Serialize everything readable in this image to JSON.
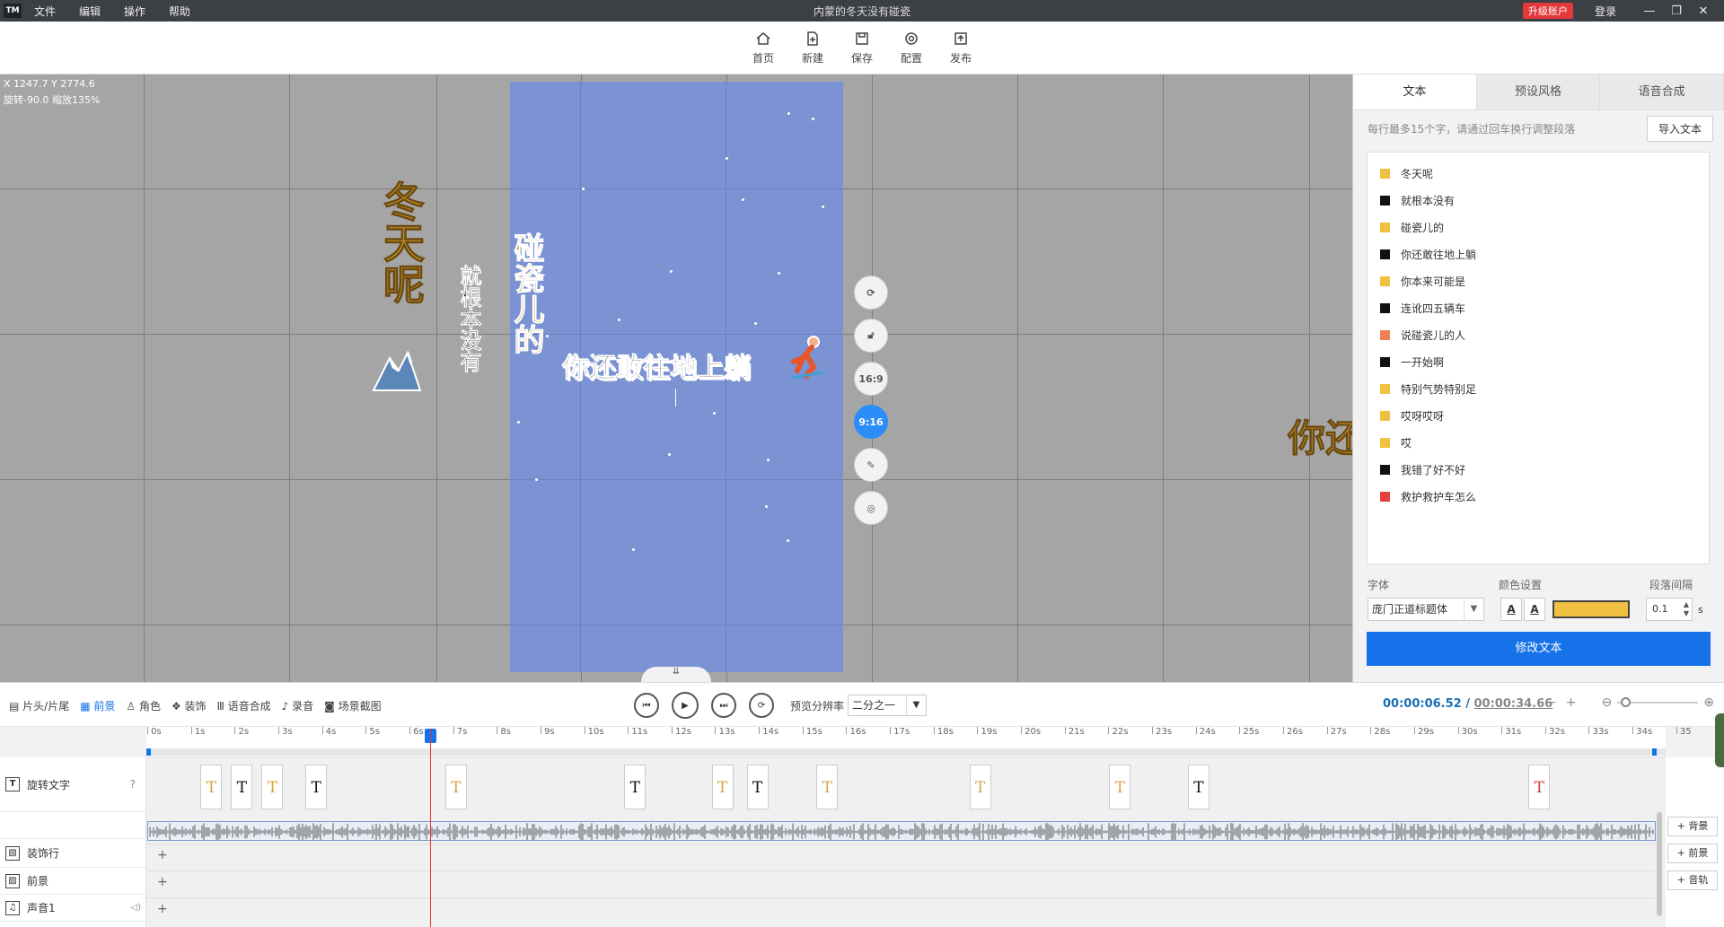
{
  "app": {
    "logo": "TM",
    "title": "内蒙的冬天没有碰瓷",
    "menu": [
      "文件",
      "编辑",
      "操作",
      "帮助"
    ],
    "upgrade_label": "升级账户",
    "login_label": "登录",
    "window_controls": [
      "minimize-icon",
      "restore-icon",
      "close-icon"
    ]
  },
  "toolbar": {
    "items": [
      {
        "label": "首页",
        "icon": "home-icon"
      },
      {
        "label": "新建",
        "icon": "new-icon"
      },
      {
        "label": "保存",
        "icon": "save-icon"
      },
      {
        "label": "配置",
        "icon": "settings-icon"
      },
      {
        "label": "发布",
        "icon": "publish-icon"
      }
    ]
  },
  "stage": {
    "coords_line1": "X 1247.7 Y 2774.6",
    "coords_line2": "旋转-90.0 缩放135%",
    "captions": {
      "c1": "冬天呢",
      "c2": "就根本没有",
      "c3": "碰瓷儿的",
      "main": "你还敢往地上躺",
      "right": "你还"
    },
    "side_buttons": [
      {
        "icon": "rotate-icon",
        "label": ""
      },
      {
        "icon": "unlock-icon",
        "label": ""
      },
      {
        "icon": "",
        "label": "16:9"
      },
      {
        "icon": "",
        "label": "9:16",
        "active": true
      },
      {
        "icon": "edit-icon",
        "label": ""
      },
      {
        "icon": "target-icon",
        "label": ""
      }
    ],
    "collapse_icon": "⇊"
  },
  "right_panel": {
    "tabs": [
      "文本",
      "预设风格",
      "语音合成"
    ],
    "hint": "每行最多15个字，请通过回车换行调整段落",
    "import_label": "导入文本",
    "lines": [
      {
        "text": "冬天呢",
        "color": "#f0c040"
      },
      {
        "text": "就根本没有",
        "color": "#111111"
      },
      {
        "text": "碰瓷儿的",
        "color": "#f0c040"
      },
      {
        "text": "你还敢往地上躺",
        "color": "#111111"
      },
      {
        "text": "你本来可能是",
        "color": "#f0c040"
      },
      {
        "text": "连讹四五辆车",
        "color": "#111111"
      },
      {
        "text": "说碰瓷儿的人",
        "color": "#f08050"
      },
      {
        "text": "一开始啊",
        "color": "#111111"
      },
      {
        "text": "特别气势特别足",
        "color": "#f0c040"
      },
      {
        "text": "哎呀哎呀",
        "color": "#f0c040"
      },
      {
        "text": "哎",
        "color": "#f0c040"
      },
      {
        "text": "我错了好不好",
        "color": "#111111"
      },
      {
        "text": "救护救护车怎么",
        "color": "#e84040"
      }
    ],
    "font_label": "字体",
    "color_label": "颜色设置",
    "spacing_label": "段落间隔",
    "font_value": "庞门正道标题体",
    "fill_color": "#f0c040",
    "spacing_value": "0.1",
    "spacing_unit": "s",
    "modify_label": "修改文本"
  },
  "timeline": {
    "toolbar": [
      {
        "label": "片头/片尾",
        "icon": "film-icon"
      },
      {
        "label": "前景",
        "icon": "grid-icon",
        "active": true
      },
      {
        "label": "角色",
        "icon": "person-icon"
      },
      {
        "label": "装饰",
        "icon": "decor-icon"
      },
      {
        "label": "语音合成",
        "icon": "tts-icon"
      },
      {
        "label": "录音",
        "icon": "mic-icon"
      },
      {
        "label": "场景截图",
        "icon": "camera-icon"
      }
    ],
    "preview_res_label": "预览分辨率",
    "preview_res_value": "二分之一",
    "current_time": "00:00:06.52",
    "separator": "/",
    "total_time": "00:00:34.66",
    "ruler_ticks": [
      "0s",
      "1s",
      "2s",
      "3s",
      "4s",
      "5s",
      "6s",
      "7s",
      "8s",
      "9s",
      "10s",
      "11s",
      "12s",
      "13s",
      "14s",
      "15s",
      "16s",
      "17s",
      "18s",
      "19s",
      "20s",
      "21s",
      "22s",
      "23s",
      "24s",
      "25s",
      "26s",
      "27s",
      "28s",
      "29s",
      "30s",
      "31s",
      "32s",
      "33s",
      "34s",
      "35"
    ],
    "tracks": [
      {
        "label": "旋转文字",
        "icon": "T"
      },
      {
        "label": "",
        "icon": ""
      },
      {
        "label": "装饰行",
        "icon": "▧"
      },
      {
        "label": "前景",
        "icon": "▨"
      },
      {
        "label": "声音1",
        "icon": "♫"
      }
    ],
    "clips": [
      {
        "t": 1.2,
        "c": "#d9a441"
      },
      {
        "t": 1.9,
        "c": "#111111"
      },
      {
        "t": 2.6,
        "c": "#d9a441"
      },
      {
        "t": 3.6,
        "c": "#111111"
      },
      {
        "t": 6.8,
        "c": "#d9a441"
      },
      {
        "t": 10.9,
        "c": "#111111"
      },
      {
        "t": 12.9,
        "c": "#d9a441"
      },
      {
        "t": 13.7,
        "c": "#111111"
      },
      {
        "t": 15.3,
        "c": "#d9a441"
      },
      {
        "t": 18.8,
        "c": "#d9a441"
      },
      {
        "t": 22.0,
        "c": "#d9a441"
      },
      {
        "t": 23.8,
        "c": "#111111"
      },
      {
        "t": 31.6,
        "c": "#d04040"
      }
    ],
    "clip_glyph": "T",
    "right_buttons": [
      "+ 背景",
      "+ 前景",
      "+ 音轨"
    ],
    "add_symbol": "+"
  }
}
